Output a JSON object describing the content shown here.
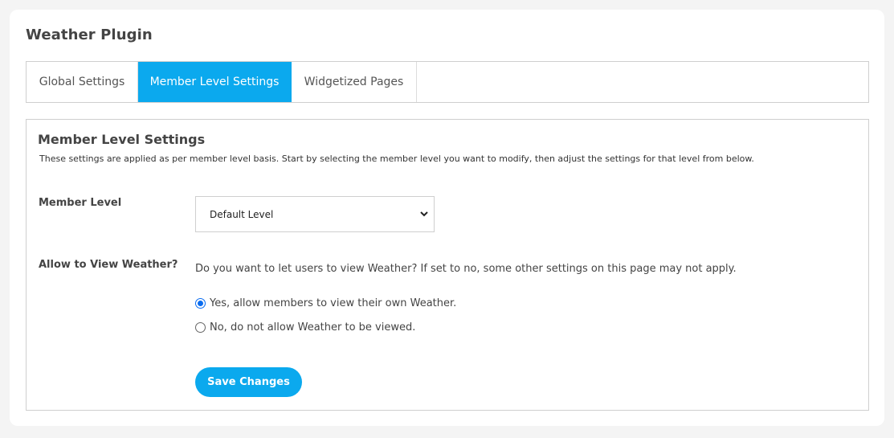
{
  "header": {
    "title": "Weather Plugin"
  },
  "tabs": [
    {
      "label": "Global Settings",
      "active": false
    },
    {
      "label": "Member Level Settings",
      "active": true
    },
    {
      "label": "Widgetized Pages",
      "active": false
    }
  ],
  "section": {
    "title": "Member Level Settings",
    "description": "These settings are applied as per member level basis. Start by selecting the member level you want to modify, then adjust the settings for that level from below."
  },
  "member_level": {
    "label": "Member Level",
    "selected": "Default Level",
    "chevron_icon": "chevron-down-icon"
  },
  "view_weather": {
    "label": "Allow to View Weather?",
    "description": "Do you want to let users to view Weather? If set to no, some other settings on this page may not apply.",
    "options": [
      {
        "label": "Yes, allow members to view their own Weather.",
        "checked": true
      },
      {
        "label": "No, do not allow Weather to be viewed.",
        "checked": false
      }
    ]
  },
  "actions": {
    "save_label": "Save Changes"
  },
  "colors": {
    "accent": "#0ba9ee",
    "radio_checked": "#0a6cf0",
    "background": "#f4f4f4"
  }
}
